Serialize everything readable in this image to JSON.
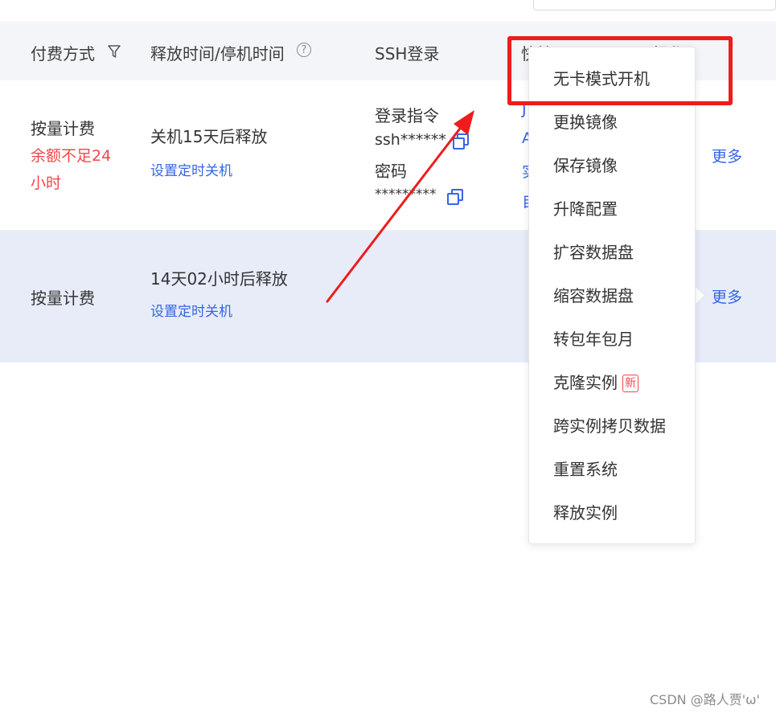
{
  "table": {
    "headers": {
      "payment": "付费方式",
      "release": "释放时间/停机时间",
      "ssh": "SSH登录",
      "shortcut": "快捷工具",
      "ops": "操作"
    },
    "rows": [
      {
        "payment": "按量计费",
        "payment_warning_1": "余额不足24",
        "payment_warning_2": "小时",
        "release_text": "关机15天后释放",
        "timer_link": "设置定时关机",
        "ssh_cmd_label": "登录指令",
        "ssh_cmd_value": "ssh******",
        "ssh_pwd_label": "密码",
        "ssh_pwd_value": "*********",
        "shortcut_fragments": [
          "J",
          "A",
          "实",
          "自"
        ],
        "more": "更多"
      },
      {
        "payment": "按量计费",
        "release_text": "14天02小时后释放",
        "timer_link": "设置定时关机",
        "more": "更多"
      }
    ]
  },
  "menu": {
    "items": [
      {
        "label": "无卡模式开机"
      },
      {
        "label": "更换镜像"
      },
      {
        "label": "保存镜像"
      },
      {
        "label": "升降配置"
      },
      {
        "label": "扩容数据盘"
      },
      {
        "label": "缩容数据盘"
      },
      {
        "label": "转包年包月"
      },
      {
        "label": "克隆实例",
        "badge": "新"
      },
      {
        "label": "跨实例拷贝数据"
      },
      {
        "label": "重置系统"
      },
      {
        "label": "释放实例"
      }
    ]
  },
  "annotation": {
    "highlight_color": "#ee1c1c",
    "highlighted_item": "无卡模式开机"
  },
  "watermark": "CSDN @路人贾'ω'"
}
